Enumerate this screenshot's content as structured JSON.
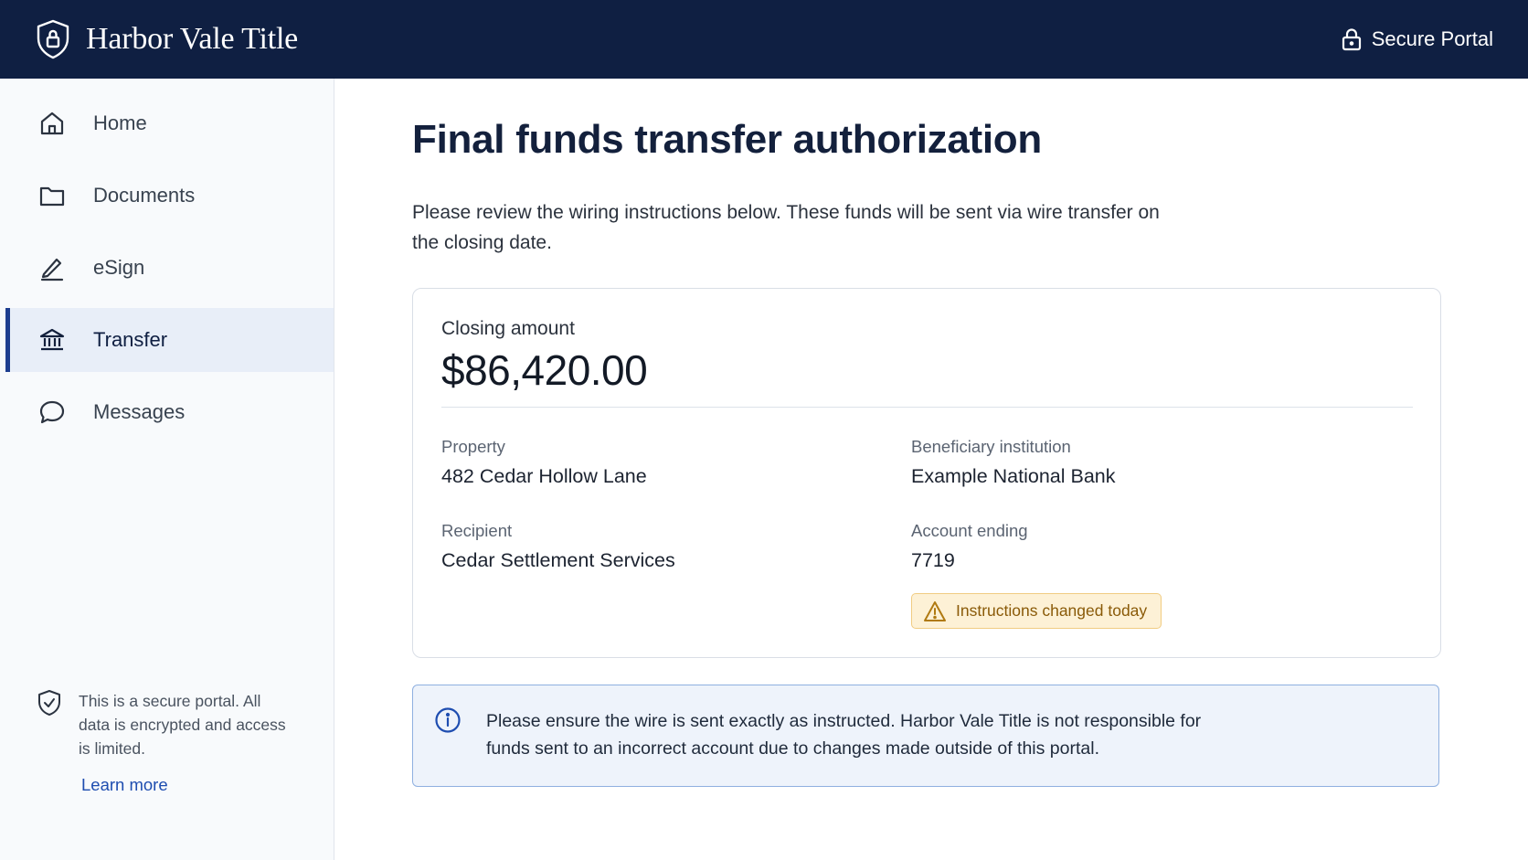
{
  "header": {
    "brand_name": "Harbor Vale Title",
    "brand_icon": "shield-lock-icon",
    "secure_label": "Secure Portal",
    "secure_icon": "lock-icon",
    "background_color": "#0f1f42"
  },
  "sidebar": {
    "items": [
      {
        "label": "Home",
        "icon": "home-icon",
        "active": false
      },
      {
        "label": "Documents",
        "icon": "folder-icon",
        "active": false
      },
      {
        "label": "eSign",
        "icon": "pen-icon",
        "active": false
      },
      {
        "label": "Transfer",
        "icon": "bank-icon",
        "active": true
      },
      {
        "label": "Messages",
        "icon": "chat-bubble-icon",
        "active": false
      }
    ],
    "footer": {
      "text": "This is a secure portal. All data is encrypted and access is limited.",
      "icon": "shield-check-icon",
      "link_label": "Learn more"
    }
  },
  "main": {
    "title": "Final funds transfer authorization",
    "intro": "Please review the wiring instructions below. These funds will be sent via wire transfer on the closing date.",
    "card": {
      "amount_label": "Closing amount",
      "amount": "$86,420.00",
      "fields": {
        "property": {
          "label": "Property",
          "value": "482 Cedar Hollow Lane"
        },
        "beneficiary": {
          "label": "Beneficiary institution",
          "value": "Example National Bank"
        },
        "recipient": {
          "label": "Recipient",
          "value": "Cedar Settlement Services"
        },
        "account": {
          "label": "Account ending",
          "value": "7719"
        }
      },
      "badge": {
        "label": "Instructions changed today",
        "icon": "warning-triangle-icon",
        "color": "#fdf1d6"
      }
    },
    "notice": {
      "icon": "info-icon",
      "text": "Please ensure the wire is sent exactly as instructed. Harbor Vale Title is not responsible for funds sent to an incorrect account due to changes made outside of this portal."
    }
  }
}
